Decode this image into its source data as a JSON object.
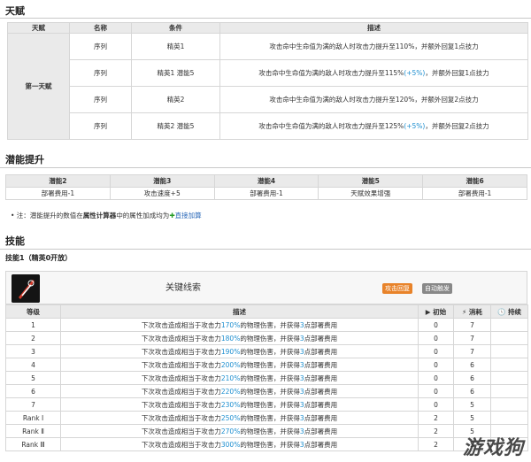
{
  "talent": {
    "title": "天赋",
    "headers": [
      "天赋",
      "名称",
      "条件",
      "描述"
    ],
    "group_label": "第一天赋",
    "rows": [
      {
        "name": "序列",
        "cond": "精英1",
        "desc": "攻击命中生命值为满的敌人时攻击力提升至110%，并额外回复1点技力",
        "bonus": ""
      },
      {
        "name": "序列",
        "cond": "精英1 潜能5",
        "desc_a": "攻击命中生命值为满的敌人时攻击力提升至115%",
        "bonus": "(+5%)",
        "desc_b": "，并额外回复1点技力"
      },
      {
        "name": "序列",
        "cond": "精英2",
        "desc": "攻击命中生命值为满的敌人时攻击力提升至120%，并额外回复2点技力",
        "bonus": ""
      },
      {
        "name": "序列",
        "cond": "精英2 潜能5",
        "desc_a": "攻击命中生命值为满的敌人时攻击力提升至125%",
        "bonus": "(+5%)",
        "desc_b": "，并额外回复2点技力"
      }
    ]
  },
  "potential": {
    "title": "潜能提升",
    "headers": [
      "潜能2",
      "潜能3",
      "潜能4",
      "潜能5",
      "潜能6"
    ],
    "values": [
      "部署费用-1",
      "攻击速度+5",
      "部署费用-1",
      "天赋效果增强",
      "部署费用-1"
    ],
    "note_prefix": "• 注：潜能提升的数值在",
    "note_bold": "属性计算器",
    "note_mid": "中的属性加成均为",
    "note_plus": "✚",
    "note_link": "直接加算"
  },
  "skills": {
    "title": "技能",
    "skill1_label": "技能1（精英0开放）",
    "skill_name": "关键线索",
    "badge_recovery": "攻击回复",
    "badge_trigger": "自动触发",
    "headers": {
      "level": "等级",
      "desc": "描述",
      "initial": "▶ 初始",
      "cost": "⚡ 消耗",
      "duration": "🕓 持续"
    },
    "desc_pre": "下次攻击造成相当于攻击力",
    "desc_mid": "的物理伤害，并获得",
    "desc_post": "点部署费用",
    "rows": [
      {
        "level": "1",
        "pct": "170%",
        "dp": "3",
        "initial": "0",
        "cost": "7",
        "duration": ""
      },
      {
        "level": "2",
        "pct": "180%",
        "dp": "3",
        "initial": "0",
        "cost": "7",
        "duration": ""
      },
      {
        "level": "3",
        "pct": "190%",
        "dp": "3",
        "initial": "0",
        "cost": "7",
        "duration": ""
      },
      {
        "level": "4",
        "pct": "200%",
        "dp": "3",
        "initial": "0",
        "cost": "6",
        "duration": ""
      },
      {
        "level": "5",
        "pct": "210%",
        "dp": "3",
        "initial": "0",
        "cost": "6",
        "duration": ""
      },
      {
        "level": "6",
        "pct": "220%",
        "dp": "3",
        "initial": "0",
        "cost": "6",
        "duration": ""
      },
      {
        "level": "7",
        "pct": "230%",
        "dp": "3",
        "initial": "0",
        "cost": "5",
        "duration": ""
      },
      {
        "level": "Rank Ⅰ",
        "pct": "250%",
        "dp": "3",
        "initial": "2",
        "cost": "5",
        "duration": ""
      },
      {
        "level": "Rank Ⅱ",
        "pct": "270%",
        "dp": "3",
        "initial": "2",
        "cost": "5",
        "duration": ""
      },
      {
        "level": "Rank Ⅲ",
        "pct": "300%",
        "dp": "3",
        "initial": "2",
        "cost": "5",
        "duration": ""
      }
    ]
  },
  "watermark": "游戏狗",
  "colors": {
    "highlight": "#1e8fd0",
    "badge_orange": "#e8832a",
    "badge_gray": "#888888",
    "header_bg": "#eaeaea"
  }
}
